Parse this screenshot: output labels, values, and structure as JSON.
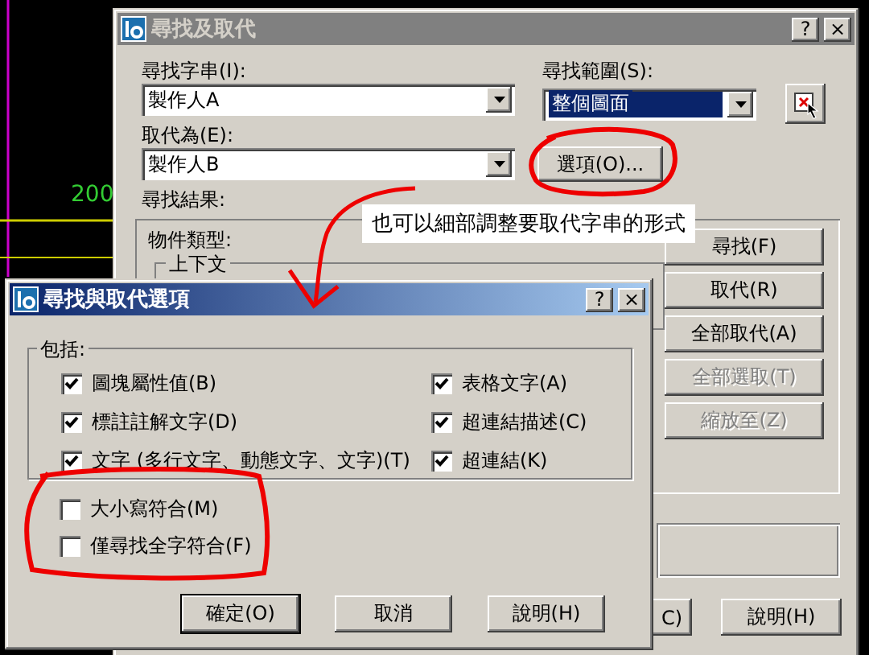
{
  "cad_background": {
    "label": "200"
  },
  "main_dialog": {
    "title": "尋找及取代",
    "title_buttons": [
      "?",
      "×"
    ],
    "find_label": "尋找字串(I):",
    "find_value": "製作人A",
    "scope_label": "尋找範圍(S):",
    "scope_value": "整個圖面",
    "replace_label": "取代為(E):",
    "replace_value": "製作人B",
    "options_button": "選項(O)...",
    "results_label": "尋找結果:",
    "object_type_label": "物件類型:",
    "context_label": "上下文",
    "side_buttons": [
      {
        "label": "尋找(F)",
        "disabled": false
      },
      {
        "label": "取代(R)",
        "disabled": false
      },
      {
        "label": "全部取代(A)",
        "disabled": false
      },
      {
        "label": "全部選取(T)",
        "disabled": true
      },
      {
        "label": "縮放至(Z)",
        "disabled": true
      }
    ],
    "bottom_buttons": [
      "C)",
      "說明(H)"
    ]
  },
  "options_dialog": {
    "title": "尋找與取代選項",
    "title_buttons": [
      "?",
      "×"
    ],
    "group_label": "包括:",
    "includes": [
      {
        "label": "圖塊屬性值(B)",
        "checked": true
      },
      {
        "label": "表格文字(A)",
        "checked": true
      },
      {
        "label": "標註註解文字(D)",
        "checked": true
      },
      {
        "label": "超連結描述(C)",
        "checked": true
      },
      {
        "label": "文字 (多行文字、動態文字、文字)(T)",
        "checked": true
      },
      {
        "label": "超連結(K)",
        "checked": true
      }
    ],
    "matches": [
      {
        "label": "大小寫符合(M)",
        "checked": false
      },
      {
        "label": "僅尋找全字符合(F)",
        "checked": false
      }
    ],
    "buttons": [
      {
        "label": "確定(O)",
        "default": true
      },
      {
        "label": "取消",
        "default": false
      },
      {
        "label": "說明(H)",
        "default": false
      }
    ]
  },
  "annotation": {
    "note": "也可以細部調整要取代字串的形式"
  }
}
